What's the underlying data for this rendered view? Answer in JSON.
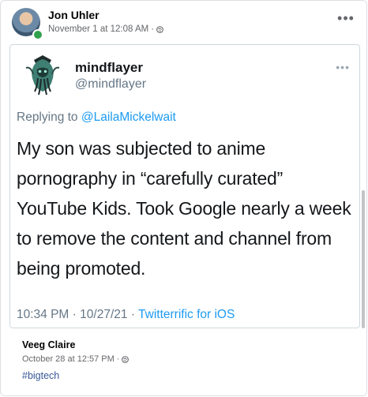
{
  "post": {
    "author": "Jon Uhler",
    "timestamp": "November 1 at 12:08 AM",
    "separator": "·",
    "more_icon": "more-horizontal-icon",
    "visibility_icon": "globe-icon"
  },
  "tweet": {
    "display_name": "mindflayer",
    "handle": "@mindflayer",
    "replying_prefix": "Replying to",
    "replying_to": "@LailaMickelwait",
    "text": "My son was subjected to anime pornography in “carefully curated” YouTube Kids. Took Google nearly a week to remove the content and channel from being promoted.",
    "time": "10:34 PM",
    "date": "10/27/21",
    "separator": "·",
    "source": "Twitterrific for iOS"
  },
  "comment": {
    "author": "Veeg Claire",
    "timestamp": "October 28 at 12:57 PM",
    "separator": "·",
    "hashtag": "#bigtech"
  },
  "colors": {
    "link_blue": "#1d9bf0",
    "fb_link": "#385898",
    "online_green": "#31a24c"
  }
}
